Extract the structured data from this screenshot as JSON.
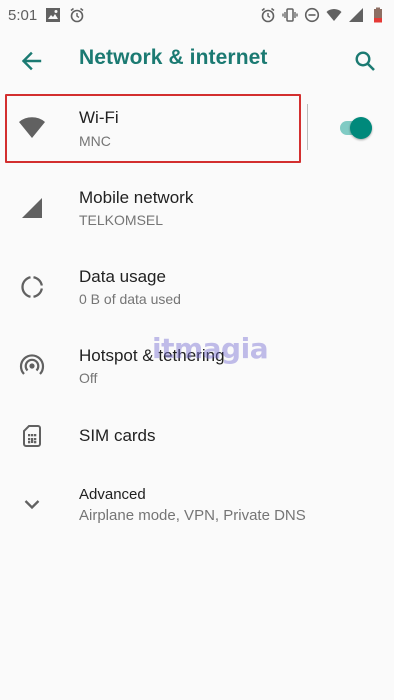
{
  "status_bar": {
    "time": "5:01",
    "left_icons": [
      "gallery-icon",
      "alarm-icon"
    ],
    "right_icons": [
      "alarm-icon",
      "vibrate-icon",
      "dnd-icon",
      "wifi-icon",
      "signal-icon",
      "battery-low-icon"
    ]
  },
  "app_bar": {
    "title": "Network & internet",
    "back_icon": "arrow-back-icon",
    "search_icon": "search-icon"
  },
  "items": [
    {
      "id": "wifi",
      "title": "Wi-Fi",
      "summary": "MNC",
      "icon": "wifi-icon",
      "toggle_on": true
    },
    {
      "id": "mobile-network",
      "title": "Mobile network",
      "summary": "TELKOMSEL",
      "icon": "cell-signal-icon"
    },
    {
      "id": "data-usage",
      "title": "Data usage",
      "summary": "0 B of data used",
      "icon": "data-usage-icon"
    },
    {
      "id": "hotspot",
      "title": "Hotspot & tethering",
      "summary": "Off",
      "icon": "hotspot-icon"
    },
    {
      "id": "sim-cards",
      "title": "SIM cards",
      "summary": "",
      "icon": "sim-card-icon"
    },
    {
      "id": "advanced",
      "title": "Advanced",
      "summary": "Airplane mode, VPN, Private DNS",
      "icon": "chevron-down-icon"
    }
  ],
  "watermark": "itmagia",
  "colors": {
    "accent": "#1b7a72",
    "toggle_thumb": "#00897b",
    "toggle_track": "#80cbc4",
    "highlight": "#d32f2f",
    "icon_gray": "#757575"
  }
}
